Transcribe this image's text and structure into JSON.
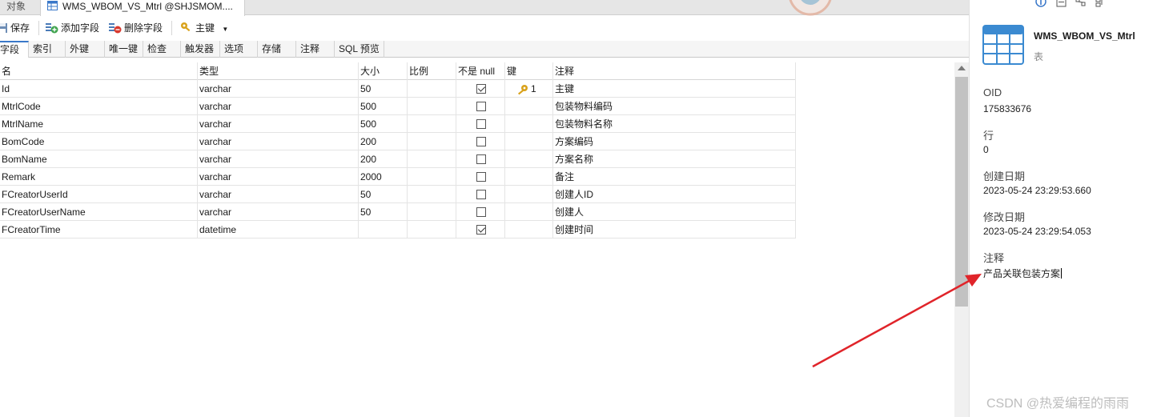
{
  "doc_tabs": {
    "objects": "对象",
    "table_tab": "WMS_WBOM_VS_Mtrl @SHJSMOM...."
  },
  "toolbar": {
    "save": "保存",
    "add_field": "添加字段",
    "delete_field": "删除字段",
    "primary_key": "主键"
  },
  "sub_tabs": [
    "字段",
    "索引",
    "外键",
    "唯一键",
    "检查",
    "触发器",
    "选项",
    "存储",
    "注释",
    "SQL 预览"
  ],
  "grid": {
    "headers": {
      "name": "名",
      "type": "类型",
      "size": "大小",
      "scale": "比例",
      "not_null": "不是 null",
      "key": "键",
      "comment": "注释"
    },
    "rows": [
      {
        "name": "Id",
        "type": "varchar",
        "size": "50",
        "scale": "",
        "not_null": true,
        "key": "1",
        "comment": "主键"
      },
      {
        "name": "MtrlCode",
        "type": "varchar",
        "size": "500",
        "scale": "",
        "not_null": false,
        "key": "",
        "comment": "包装物料编码"
      },
      {
        "name": "MtrlName",
        "type": "varchar",
        "size": "500",
        "scale": "",
        "not_null": false,
        "key": "",
        "comment": "包装物料名称"
      },
      {
        "name": "BomCode",
        "type": "varchar",
        "size": "200",
        "scale": "",
        "not_null": false,
        "key": "",
        "comment": "方案编码"
      },
      {
        "name": "BomName",
        "type": "varchar",
        "size": "200",
        "scale": "",
        "not_null": false,
        "key": "",
        "comment": "方案名称"
      },
      {
        "name": "Remark",
        "type": "varchar",
        "size": "2000",
        "scale": "",
        "not_null": false,
        "key": "",
        "comment": "备注"
      },
      {
        "name": "FCreatorUserId",
        "type": "varchar",
        "size": "50",
        "scale": "",
        "not_null": false,
        "key": "",
        "comment": "创建人ID"
      },
      {
        "name": "FCreatorUserName",
        "type": "varchar",
        "size": "50",
        "scale": "",
        "not_null": false,
        "key": "",
        "comment": "创建人"
      },
      {
        "name": "FCreatorTime",
        "type": "datetime",
        "size": "",
        "scale": "",
        "not_null": true,
        "key": "",
        "comment": "创建时间"
      }
    ]
  },
  "info_panel": {
    "object_name": "WMS_WBOM_VS_Mtrl",
    "object_kind": "表",
    "fields": [
      {
        "label": "OID",
        "value": "175833676"
      },
      {
        "label": "行",
        "value": "0"
      },
      {
        "label": "创建日期",
        "value": "2023-05-24 23:29:53.660"
      },
      {
        "label": "修改日期",
        "value": "2023-05-24 23:29:54.053"
      },
      {
        "label": "注释",
        "value": "产品关联包装方案"
      }
    ]
  },
  "watermark": "CSDN @热爱编程的雨雨",
  "colors": {
    "accent": "#3a78c9",
    "annotation_arrow": "#e0242a",
    "key_icon": "#d9a21b"
  }
}
